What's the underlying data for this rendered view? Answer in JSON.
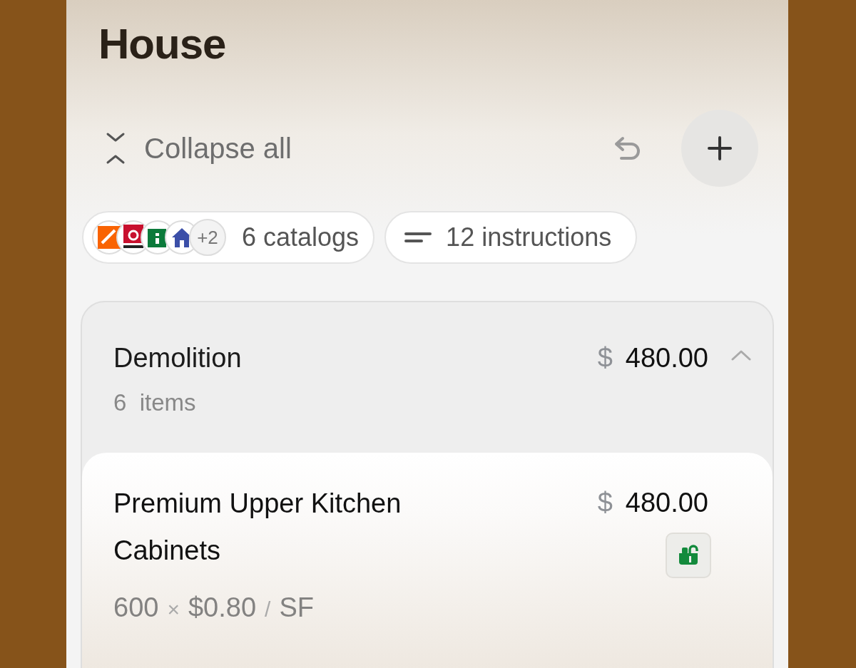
{
  "title": "House",
  "toolbar": {
    "collapse_label": "Collapse all"
  },
  "catalogs": {
    "logos": [
      {
        "color": "#f96302"
      },
      {
        "color": "#c8102e"
      },
      {
        "color": "#0b7a3b"
      },
      {
        "color": "#3b4fa8"
      }
    ],
    "more": "+2",
    "label": "6 catalogs"
  },
  "instructions": {
    "label": "12 instructions"
  },
  "section": {
    "name": "Demolition",
    "count": "6",
    "count_label": "items",
    "currency": "$",
    "amount": "480.00",
    "expanded": true,
    "items": [
      {
        "name": "Premium Upper Kitchen Cabinets",
        "currency": "$",
        "amount": "480.00",
        "quantity": "600",
        "times": "×",
        "unit_price": "$0.80",
        "per": "/",
        "unit": "SF"
      }
    ]
  }
}
